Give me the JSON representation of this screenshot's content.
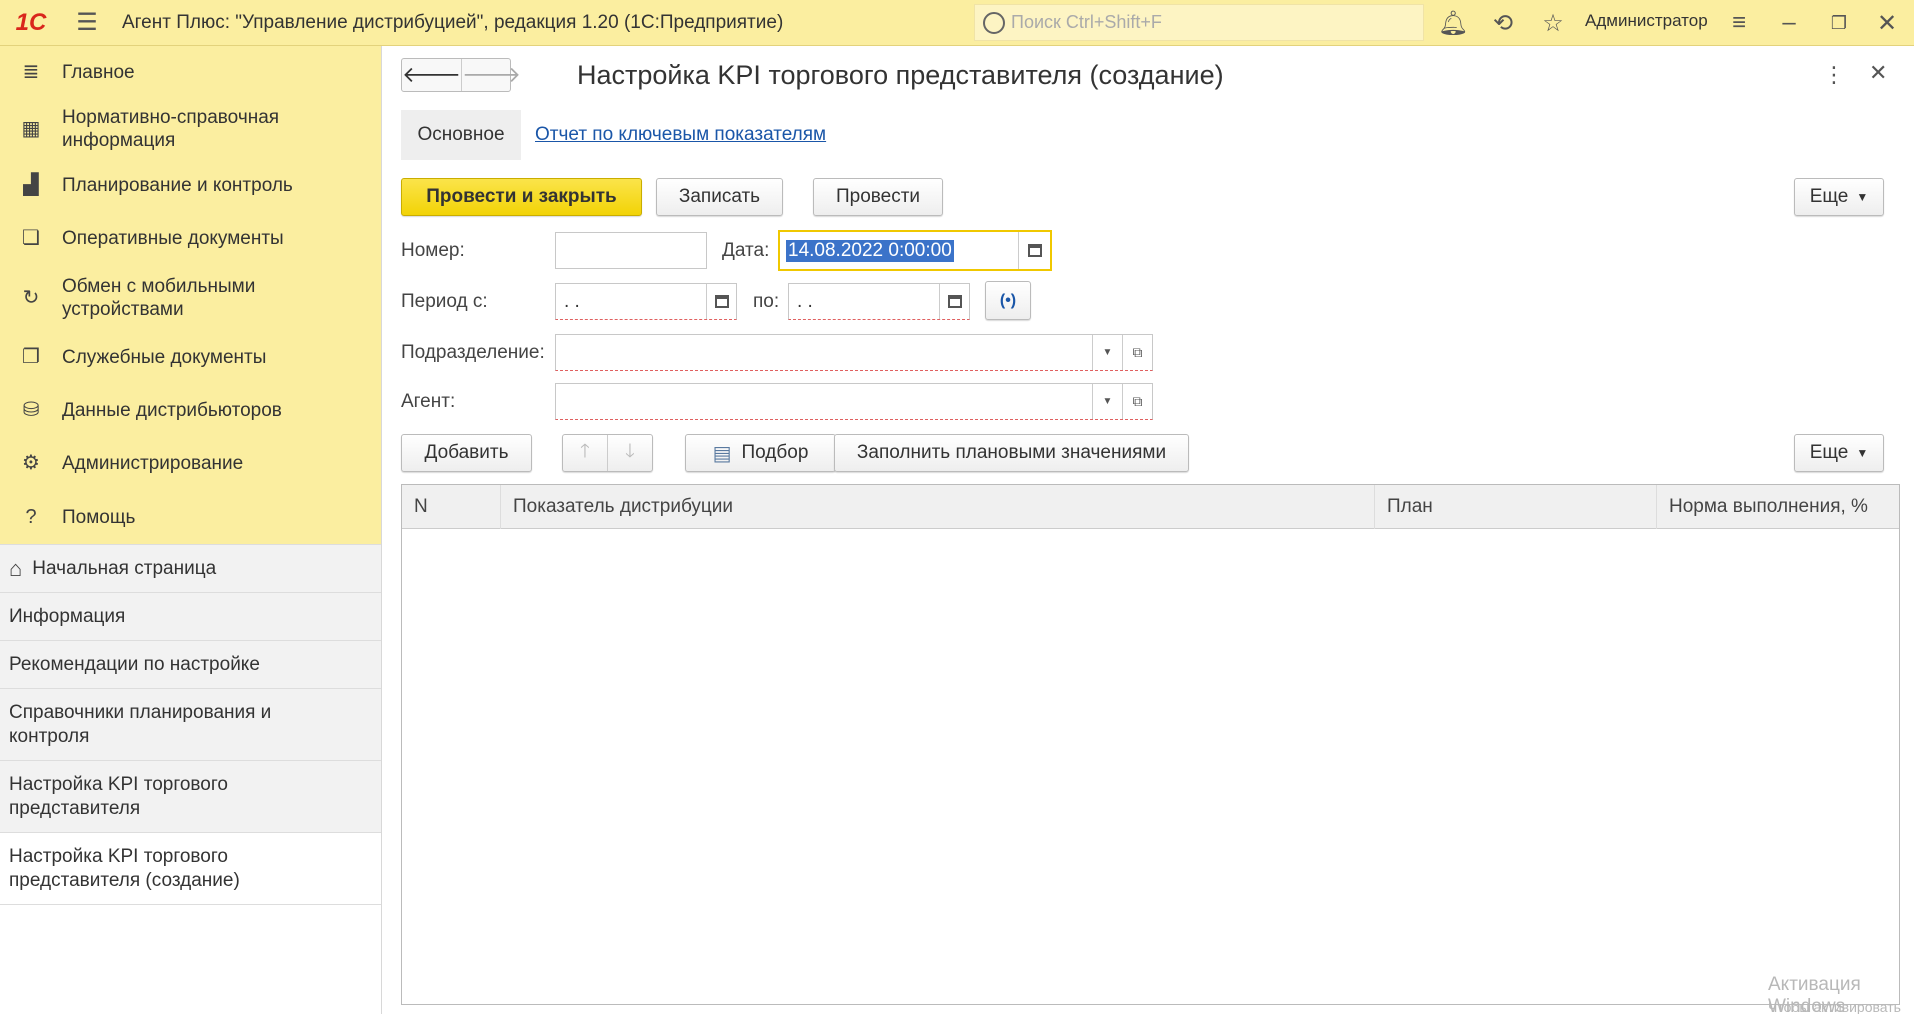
{
  "app": {
    "logo_text": "1С",
    "title": "Агент Плюс: \"Управление дистрибуцией\", редакция 1.20  (1С:Предприятие)",
    "search_placeholder": "Поиск Ctrl+Shift+F",
    "user": "Администратор"
  },
  "sections": [
    {
      "icon": "menu-lines-icon",
      "label": "Главное"
    },
    {
      "icon": "reference-grid-icon",
      "label": "Нормативно-справочная информация"
    },
    {
      "icon": "bar-chart-icon",
      "label": "Планирование и контроль"
    },
    {
      "icon": "documents-icon",
      "label": "Оперативные документы"
    },
    {
      "icon": "sync-icon",
      "label": "Обмен с мобильными устройствами"
    },
    {
      "icon": "service-docs-icon",
      "label": "Служебные документы"
    },
    {
      "icon": "distributor-data-icon",
      "label": "Данные дистрибьюторов"
    },
    {
      "icon": "gear-icon",
      "label": "Администрирование"
    },
    {
      "icon": "question-icon",
      "label": "Помощь"
    }
  ],
  "open_windows": [
    {
      "label": "Начальная страница"
    },
    {
      "label": "Информация"
    },
    {
      "label": "Рекомендации по настройке"
    },
    {
      "label": "Справочники планирования и контроля"
    },
    {
      "label": "Настройка KPI торгового представителя"
    },
    {
      "label": "Настройка KPI торгового представителя (создание)"
    }
  ],
  "form": {
    "title": "Настройка KPI торгового представителя (создание)",
    "tab_main": "Основное",
    "tab_report": "Отчет по ключевым показателям",
    "buttons": {
      "post_close": "Провести и закрыть",
      "save": "Записать",
      "post": "Провести",
      "more": "Еще"
    },
    "fields": {
      "number_label": "Номер:",
      "number_value": "",
      "date_label": "Дата:",
      "date_value": "14.08.2022  0:00:00",
      "period_from_label": "Период с:",
      "period_from_value": " .  .",
      "period_to_label": "по:",
      "period_to_value": " .  .",
      "division_label": "Подразделение:",
      "division_value": "",
      "agent_label": "Агент:",
      "agent_value": ""
    },
    "table_toolbar": {
      "add": "Добавить",
      "pick": "Подбор",
      "fill_plan": "Заполнить плановыми значениями",
      "more": "Еще"
    },
    "table": {
      "columns": [
        "N",
        "Показатель дистрибуции",
        "План",
        "Норма выполнения, %"
      ],
      "rows": []
    }
  },
  "watermark": {
    "line1": "Активация Windows",
    "line2": "Чтобы активировать Windows, перейдите в раздел \"Параметры\"."
  }
}
